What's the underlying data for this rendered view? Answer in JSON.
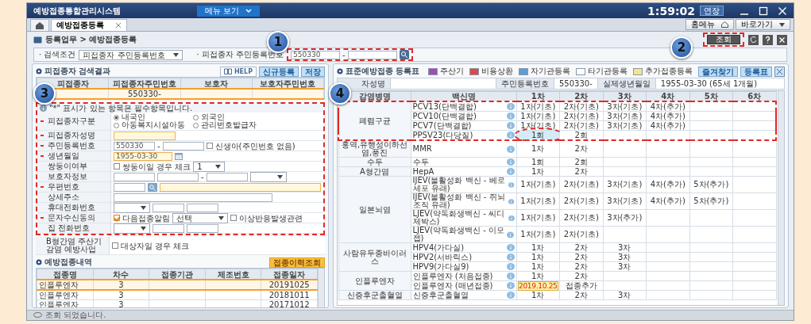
{
  "window": {
    "title": "예방접종통합관리시스템",
    "menu_button": "메뉴 보기",
    "clock": "1:59:02",
    "extend_button": "연장"
  },
  "tabs": [
    {
      "label": "예방접종등록",
      "selected": true
    }
  ],
  "top_buttons": [
    "홈메뉴",
    "바로가기"
  ],
  "breadcrumb": "등록업무 > 예방접종등록",
  "search": {
    "condition_label": "· 검색조건",
    "condition_value": "피접종자 주민등록번호",
    "id_label": "· 피접종자 주민등록번호",
    "id_front": "550330",
    "separator": "-",
    "query_button": "조회"
  },
  "callouts": [
    "1",
    "2",
    "3",
    "4"
  ],
  "results": {
    "title": "피접종자 검색결과",
    "buttons": [
      "HELP",
      "신규등록",
      "저장"
    ],
    "columns": [
      "피접종자",
      "피접종자주민번호",
      "보호자",
      "보호자주민번호"
    ],
    "rows": [
      {
        "id": "550330-",
        "selected": true
      }
    ]
  },
  "form": {
    "groups": [
      {
        "framed": true,
        "note": "\"*\" 표시가 있는 항목은 필수항목입니다.",
        "fields": [
          {
            "label": "피접종자구분",
            "required": true,
            "kind": "radio",
            "options": [
              {
                "label": "내국인",
                "selected": true
              },
              {
                "label": "외국인",
                "selected": false
              },
              {
                "label": "아동복지시설아동",
                "selected": false
              },
              {
                "label": "관리번호발급자",
                "selected": false
              }
            ]
          },
          {
            "label": "피접종자성명",
            "required": true,
            "kind": "text",
            "highlight": true
          },
          {
            "label": "주민등록번호",
            "required": true,
            "kind": "id",
            "value": "550330",
            "separator": "-",
            "checkbox": {
              "label": "신생아(주민번호 없음)",
              "checked": false
            }
          },
          {
            "label": "생년월일",
            "required": true,
            "kind": "date",
            "value": "1955-03-30"
          },
          {
            "label": "쌍둥이여부",
            "required": false,
            "kind": "twin",
            "checkbox": {
              "label": "쌍둥이일 경우 체크",
              "checked": false
            },
            "select": "1"
          },
          {
            "label": "보호자정보",
            "required": false,
            "kind": "guardian",
            "separator": "-"
          },
          {
            "label": "우편번호",
            "required": true,
            "kind": "postal"
          },
          {
            "label": "상세주소",
            "required": false,
            "kind": "text",
            "highlight": false
          },
          {
            "label": "휴대전화번호",
            "required": false,
            "kind": "phone"
          },
          {
            "label": "문자수신동의",
            "required": true,
            "kind": "sms",
            "checkbox": {
              "label": "다음접종알림",
              "checked": true
            },
            "select": "선택",
            "checkbox2": {
              "label": "이상반응발생관련",
              "checked": false
            }
          },
          {
            "label": "집 전화번호",
            "required": false,
            "kind": "phone"
          }
        ]
      },
      {
        "framed": false,
        "fields": [
          {
            "label": "B형간염 주산기 감염 예방사업",
            "required": false,
            "kind": "check",
            "checkbox": {
              "label": "대상자일 경우 체크",
              "checked": false
            }
          }
        ]
      }
    ]
  },
  "history": {
    "title": "예방접종내역",
    "button": "접종이력조회",
    "columns": [
      "접종명",
      "차수",
      "접종기관",
      "제조번호",
      "접종일자"
    ],
    "rows": [
      {
        "name": "인플루엔자",
        "dose": "3",
        "date": "20191025",
        "selected": true
      },
      {
        "name": "인플루엔자",
        "dose": "3",
        "date": "20181011",
        "selected": false
      },
      {
        "name": "인플루엔자",
        "dose": "3",
        "date": "20171012",
        "selected": false
      }
    ]
  },
  "register": {
    "title": "표준예방접종 등록표",
    "legend": [
      {
        "label": "주산기",
        "color": "#a04fb0"
      },
      {
        "label": "비용상환",
        "color": "#e04848"
      },
      {
        "label": "자기관등록",
        "color": "#5c9fd6"
      },
      {
        "label": "타기관등록",
        "color": "#ffffff"
      },
      {
        "label": "추가접종등록",
        "color": "#f6e38e"
      }
    ],
    "buttons": [
      "즐겨찾기",
      "등록표"
    ],
    "info": [
      {
        "label": "자성명"
      },
      {
        "label": "주민등록번호",
        "value": "550330-"
      },
      {
        "label": "실제생년월일",
        "value": "1955-03-30 (65세 1개월)"
      }
    ],
    "columns": [
      "감염병명",
      "백신명",
      "1차",
      "2차",
      "3차",
      "4차",
      "5차",
      "6차"
    ],
    "groups": [
      {
        "disease": "폐렴구균",
        "framed": true,
        "vaccines": [
          {
            "name": "PCV13(단백결합)",
            "kind": "plain",
            "circled": false,
            "doses": [
              "1차(기초)",
              "2차(기초)",
              "3차(기초)",
              "4차(추가)"
            ]
          },
          {
            "name": "PCV10(단백결합)",
            "kind": "plain",
            "circled": false,
            "doses": [
              "1차(기초)",
              "2차(기초)",
              "3차(기초)",
              "4차(추가)"
            ]
          },
          {
            "name": "PCV7(단백결합)",
            "kind": "plain",
            "circled": false,
            "doses": [
              "1차(기초)",
              "2차(기초)",
              "3차(기초)",
              "4차(추가)"
            ]
          },
          {
            "name": "PPSV23(다당질)",
            "kind": "self",
            "circled": true,
            "doses": [
              "1회",
              "2회"
            ]
          }
        ]
      },
      {
        "disease": "홍역,유행성이하선염,풍진",
        "framed": false,
        "vaccines": [
          {
            "name": "MMR",
            "kind": "plain",
            "circled": false,
            "doses": [
              "1차",
              "2차"
            ]
          }
        ]
      },
      {
        "disease": "수두",
        "framed": false,
        "vaccines": [
          {
            "name": "수두",
            "kind": "plain",
            "circled": false,
            "doses": [
              "1회",
              "2회"
            ]
          }
        ]
      },
      {
        "disease": "A형간염",
        "framed": false,
        "vaccines": [
          {
            "name": "HepA",
            "kind": "plain",
            "circled": false,
            "doses": [
              "1차",
              "2차"
            ]
          }
        ]
      },
      {
        "disease": "일본뇌염",
        "framed": false,
        "vaccines": [
          {
            "name": "IJEV(불활성화 백신 - 베로세포 유래)",
            "kind": "plain",
            "circled": false,
            "doses": [
              "1차(기초)",
              "2차(기초)",
              "3차(기초)",
              "4차(추가)",
              "5차(추가)"
            ]
          },
          {
            "name": "IJEV(불활성화 백신 - 쥐뇌조직 유래)",
            "kind": "plain",
            "circled": false,
            "doses": [
              "1차(기초)",
              "2차(기초)",
              "3차(기초)",
              "4차(추가)",
              "5차(추가)"
            ]
          },
          {
            "name": "LJEV(약독화생백신 - 씨디제박스)",
            "kind": "plain",
            "circled": false,
            "doses": [
              "1차(기초)",
              "2차(기초)",
              "3차(추가)"
            ]
          },
          {
            "name": "LJEV(약독화생백신 - 이모젭)",
            "kind": "plain",
            "circled": false,
            "doses": [
              "1차(기초)",
              "2차(기초)"
            ]
          }
        ]
      },
      {
        "disease": "사람유두종바이러스",
        "framed": false,
        "vaccines": [
          {
            "name": "HPV4(가다실)",
            "kind": "plain",
            "circled": false,
            "doses": [
              "1차",
              "2차",
              "3차"
            ]
          },
          {
            "name": "HPV2(서바릭스)",
            "kind": "plain",
            "circled": false,
            "doses": [
              "1차",
              "2차",
              "3차"
            ]
          },
          {
            "name": "HPV9(가다실9)",
            "kind": "plain",
            "circled": false,
            "doses": [
              "1차",
              "2차",
              "3차"
            ]
          }
        ]
      },
      {
        "disease": "인플루엔자",
        "framed": false,
        "vaccines": [
          {
            "name": "인플루엔자 (처음접종)",
            "kind": "plain",
            "circled": false,
            "doses": [
              "1차",
              "2차"
            ]
          },
          {
            "name": "인플루엔자 (매년접종)",
            "kind": "date",
            "circled": false,
            "doses": [
              "2019.10.25",
              "접종추가"
            ]
          }
        ]
      },
      {
        "disease": "신증후군출혈열",
        "framed": false,
        "vaccines": [
          {
            "name": "신증후군출혈열",
            "kind": "plain",
            "circled": false,
            "doses": [
              "1차",
              "2차",
              "3차"
            ]
          }
        ]
      }
    ]
  },
  "status_bar": "조회 되었습니다."
}
